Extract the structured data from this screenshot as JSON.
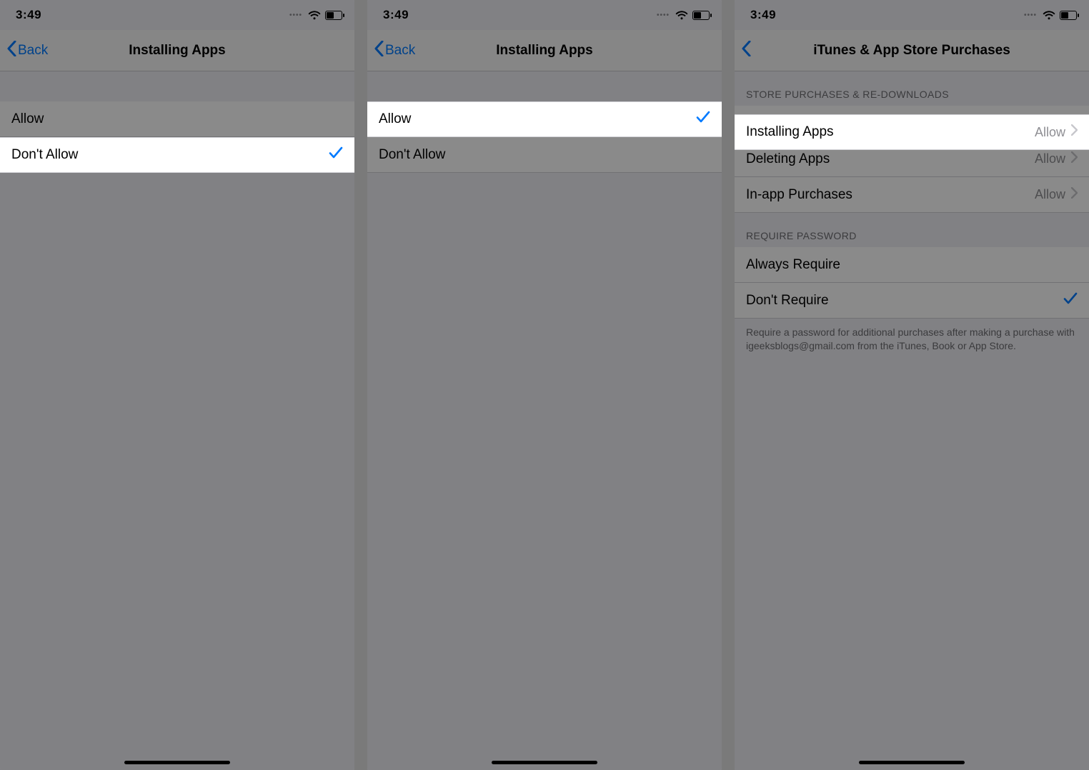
{
  "status": {
    "time": "3:49"
  },
  "colors": {
    "accent": "#007aff",
    "secondary": "#8e8e93"
  },
  "screen1": {
    "back_label": "Back",
    "title": "Installing Apps",
    "options": [
      {
        "label": "Allow",
        "selected": false
      },
      {
        "label": "Don't Allow",
        "selected": true
      }
    ],
    "highlight_index": 1
  },
  "screen2": {
    "back_label": "Back",
    "title": "Installing Apps",
    "options": [
      {
        "label": "Allow",
        "selected": true
      },
      {
        "label": "Don't Allow",
        "selected": false
      }
    ],
    "highlight_index": 0
  },
  "screen3": {
    "title": "iTunes & App Store Purchases",
    "section1_header": "STORE PURCHASES & RE-DOWNLOADS",
    "rows": [
      {
        "label": "Installing Apps",
        "value": "Allow"
      },
      {
        "label": "Deleting Apps",
        "value": "Allow"
      },
      {
        "label": "In-app Purchases",
        "value": "Allow"
      }
    ],
    "highlight_row": 0,
    "section2_header": "REQUIRE PASSWORD",
    "password_options": [
      {
        "label": "Always Require",
        "selected": false
      },
      {
        "label": "Don't Require",
        "selected": true
      }
    ],
    "footer": "Require a password for additional purchases after making a purchase with igeeksblogs@gmail.com from the iTunes, Book or App Store."
  }
}
